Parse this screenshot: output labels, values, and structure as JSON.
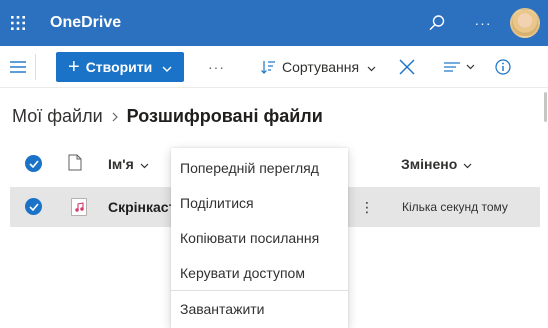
{
  "header": {
    "app_title": "OneDrive",
    "waffle_icon": "app-launcher-icon",
    "search_icon": "search-icon",
    "more_label": "···",
    "avatar": "user-avatar"
  },
  "command_bar": {
    "create_label": "Створити",
    "more_label": "···",
    "sort_label": "Сортування"
  },
  "breadcrumb": {
    "root": "Мої файли",
    "separator": ">",
    "current": "Розшифровані файли"
  },
  "list": {
    "columns": {
      "name": "Ім'я",
      "modified": "Змінено"
    },
    "rows": [
      {
        "name": "Скрінкаст",
        "modified": "Кілька секунд тому",
        "more": "⋮"
      }
    ]
  },
  "context_menu": {
    "items": [
      "Попередній перегляд",
      "Поділитися",
      "Копіювати посилання",
      "Керувати доступом",
      "Завантажити"
    ]
  },
  "colors": {
    "header_bg": "#2b71c0",
    "accent": "#1a73c7",
    "selected_row": "#e5e5e5"
  }
}
